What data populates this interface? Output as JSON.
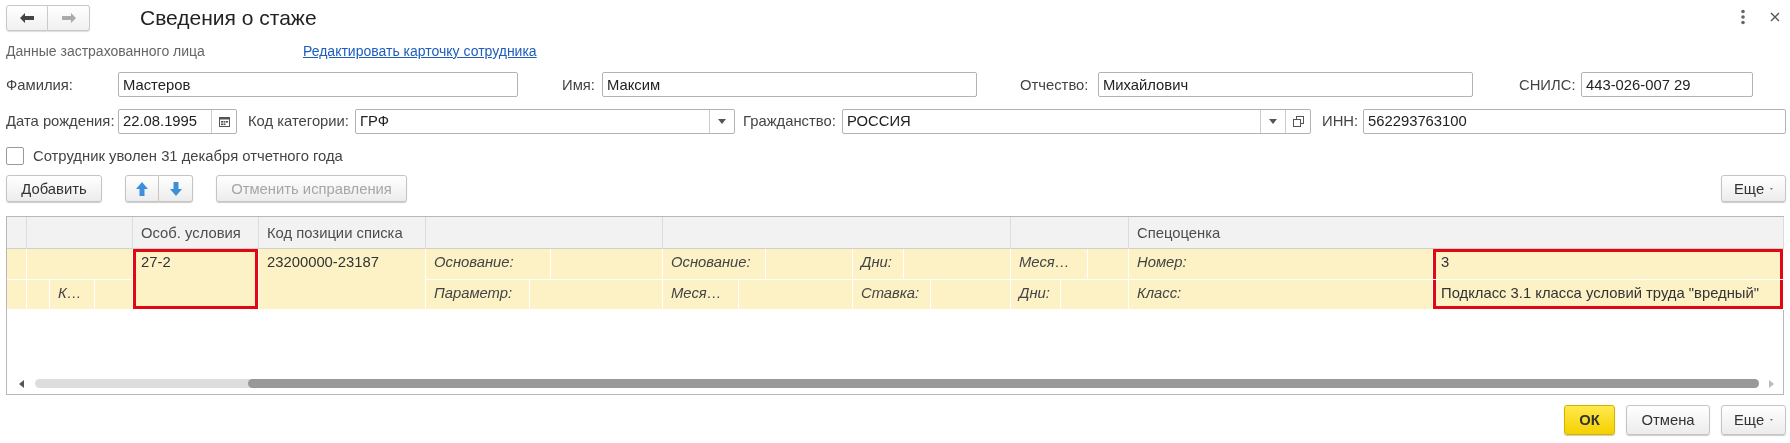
{
  "window": {
    "title": "Сведения о стаже",
    "nav": [
      {
        "kind": "back",
        "disabled": false
      },
      {
        "kind": "forward",
        "disabled": true
      }
    ]
  },
  "insured_person": {
    "caption": "Данные застрахованного лица",
    "edit_link": "Редактировать карточку сотрудника"
  },
  "fields_row_1": [
    {
      "label": "Фамилия:",
      "value": "Мастеров"
    },
    {
      "label": "Имя:",
      "value": "Максим"
    },
    {
      "label": "Отчество:",
      "value": "Михайлович"
    },
    {
      "label": "СНИЛС:",
      "value": "443-026-007 29"
    }
  ],
  "fields_row_2": [
    {
      "label": "Дата рождения:",
      "value": "22.08.1995",
      "kind": "date"
    },
    {
      "label": "Код категории:",
      "value": "ГРФ",
      "kind": "select"
    },
    {
      "label": "Гражданство:",
      "value": "РОССИЯ",
      "kind": "select_open"
    },
    {
      "label": "ИНН:",
      "value": "562293763100",
      "kind": "text"
    }
  ],
  "dismissed": {
    "label": "Сотрудник уволен 31 декабря отчетного года",
    "checked": false
  },
  "toolbar": {
    "add": "Добавить",
    "cancel_fixes": {
      "label": "Отменить исправления",
      "disabled": true
    },
    "more": "Еще"
  },
  "table": {
    "header": [
      "Особ. условия",
      "Код позиции списка",
      "Спецоценка"
    ],
    "row": {
      "selected": true,
      "cells": [
        {
          "text": "27-2",
          "kind": "value",
          "highlighted": true
        },
        {
          "text": "23200000-23187",
          "kind": "value",
          "highlighted": false
        },
        {
          "text": "Основание:",
          "kind": "label",
          "highlighted": false
        },
        {
          "text": "Основание:",
          "kind": "label",
          "highlighted": false
        },
        {
          "text": "Дни:",
          "kind": "label",
          "highlighted": false
        },
        {
          "text": "Меся…",
          "kind": "label",
          "highlighted": false
        },
        {
          "text": "Номер:",
          "kind": "label",
          "highlighted": false
        },
        {
          "text": "3",
          "kind": "value",
          "highlighted": true
        },
        {
          "text": "К…",
          "kind": "label",
          "highlighted": false
        },
        {
          "text": "Параметр:",
          "kind": "label",
          "highlighted": false
        },
        {
          "text": "Меся…",
          "kind": "label",
          "highlighted": false
        },
        {
          "text": "Ставка:",
          "kind": "label",
          "highlighted": false
        },
        {
          "text": "Дни:",
          "kind": "label",
          "highlighted": false
        },
        {
          "text": "Класс:",
          "kind": "label",
          "highlighted": false
        },
        {
          "text": "Подкласс 3.1 класса условий труда \"вредный\"",
          "kind": "value",
          "highlighted": true
        }
      ]
    }
  },
  "footer_buttons": [
    {
      "label": "ОК",
      "kind": "primary"
    },
    {
      "label": "Отмена",
      "kind": "normal"
    },
    {
      "label": "Еще",
      "kind": "menu"
    }
  ]
}
